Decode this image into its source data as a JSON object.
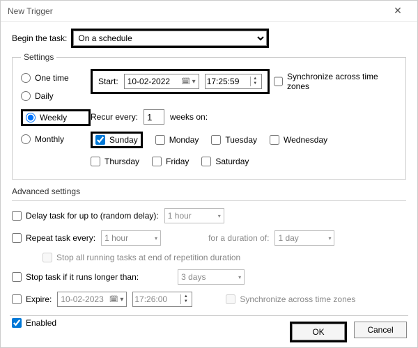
{
  "window": {
    "title": "New Trigger",
    "close_glyph": "✕"
  },
  "begin": {
    "label": "Begin the task:",
    "value": "On a schedule"
  },
  "settings": {
    "legend": "Settings",
    "freq": {
      "one_time": "One time",
      "daily": "Daily",
      "weekly": "Weekly",
      "monthly": "Monthly",
      "selected": "weekly"
    },
    "start": {
      "label": "Start:",
      "date": "10-02-2022",
      "time": "17:25:59",
      "sync_label": "Synchronize across time zones"
    },
    "recur": {
      "label_pre": "Recur every:",
      "value": "1",
      "label_post": "weeks on:"
    },
    "days": {
      "sunday": "Sunday",
      "monday": "Monday",
      "tuesday": "Tuesday",
      "wednesday": "Wednesday",
      "thursday": "Thursday",
      "friday": "Friday",
      "saturday": "Saturday"
    }
  },
  "advanced": {
    "heading": "Advanced settings",
    "delay": {
      "label": "Delay task for up to (random delay):",
      "value": "1 hour"
    },
    "repeat": {
      "label": "Repeat task every:",
      "value": "1 hour",
      "duration_label": "for a duration of:",
      "duration_value": "1 day"
    },
    "stop_all": "Stop all running tasks at end of repetition duration",
    "stop_long": {
      "label": "Stop task if it runs longer than:",
      "value": "3 days"
    },
    "expire": {
      "label": "Expire:",
      "date": "10-02-2023",
      "time": "17:26:00",
      "sync_label": "Synchronize across time zones"
    },
    "enabled_label": "Enabled"
  },
  "buttons": {
    "ok": "OK",
    "cancel": "Cancel"
  }
}
